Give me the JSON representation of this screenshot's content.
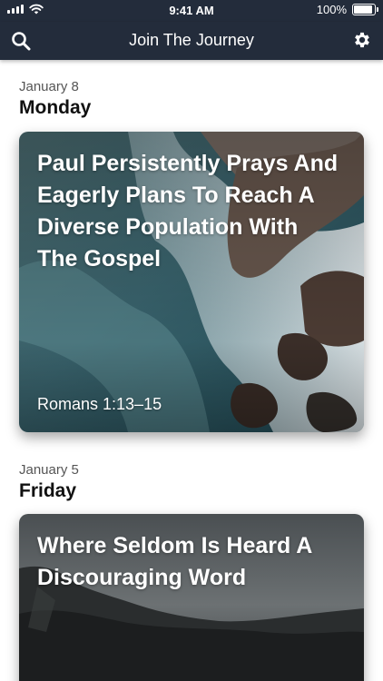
{
  "status_bar": {
    "time": "9:41 AM",
    "battery": "100%",
    "battery_level": 1.0
  },
  "nav": {
    "title": "Join The Journey",
    "left_icon": "search-icon",
    "right_icon": "gear-icon"
  },
  "entries": [
    {
      "date": "January 8",
      "weekday": "Monday",
      "card_title": "Paul Persistently Prays And Eagerly Plans To Reach A Diverse Population With The Gospel",
      "reference": "Romans 1:13–15"
    },
    {
      "date": "January 5",
      "weekday": "Friday",
      "card_title": "Where Seldom Is Heard A Discouraging Word",
      "reference": ""
    }
  ],
  "colors": {
    "nav_bg": "#232c3b",
    "text_primary": "#111111",
    "text_secondary": "#555555"
  }
}
